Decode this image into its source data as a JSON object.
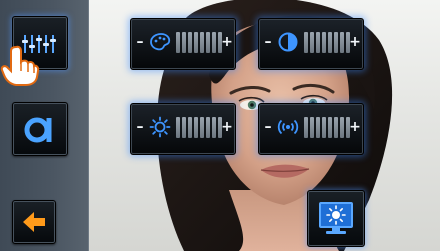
{
  "left_panel": {
    "buttons": [
      {
        "id": "settings",
        "icon": "equalizer-icon"
      },
      {
        "id": "mode",
        "icon": "a-icon"
      },
      {
        "id": "back",
        "icon": "arrow-left-icon"
      }
    ]
  },
  "controls": [
    {
      "id": "color",
      "icon": "color-palette-icon",
      "minus": "–",
      "plus": "+",
      "segments": 8,
      "level": 0
    },
    {
      "id": "contrast",
      "icon": "contrast-icon",
      "minus": "–",
      "plus": "+",
      "segments": 8,
      "level": 0
    },
    {
      "id": "brightness",
      "icon": "brightness-icon",
      "minus": "–",
      "plus": "+",
      "segments": 8,
      "level": 0
    },
    {
      "id": "volume",
      "icon": "volume-icon",
      "minus": "–",
      "plus": "+",
      "segments": 8,
      "level": 0
    }
  ],
  "display_button": {
    "icon": "monitor-brightness-icon"
  },
  "colors": {
    "accent_blue": "#2f8cff",
    "icon_blue": "#4aa3ff",
    "arrow_orange": "#ff9a1a"
  }
}
